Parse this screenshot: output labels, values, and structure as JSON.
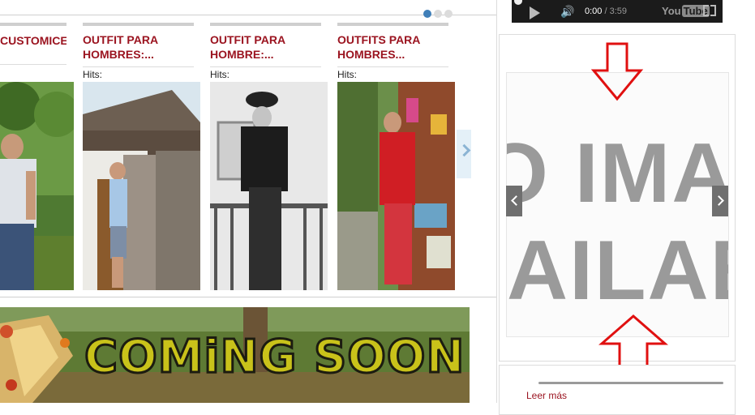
{
  "carousel": {
    "cards": [
      {
        "title": "CUSTOMICED",
        "hits_label": ""
      },
      {
        "title": "OUTFIT PARA HOMBRES:...",
        "hits_label": "Hits:"
      },
      {
        "title": "OUTFIT PARA HOMBRE:...",
        "hits_label": "Hits:"
      },
      {
        "title": "OUTFITS PARA HOMBRES...",
        "hits_label": "Hits:"
      }
    ],
    "page_dots": 3,
    "active_dot": 1
  },
  "banner": {
    "text": "COMiNG SOON"
  },
  "video_player": {
    "current_time": "0:00",
    "separator": " / ",
    "duration": "3:59",
    "brand_left": "You",
    "brand_right": "Tube"
  },
  "image_slider": {
    "placeholder_line1": "O IMAG",
    "placeholder_line2": "AILAB"
  },
  "read_more": {
    "label": "Leer más"
  },
  "colors": {
    "title_red": "#9b1420",
    "dot_active": "#3f7fb8",
    "annotation_arrow": "#e01010"
  }
}
